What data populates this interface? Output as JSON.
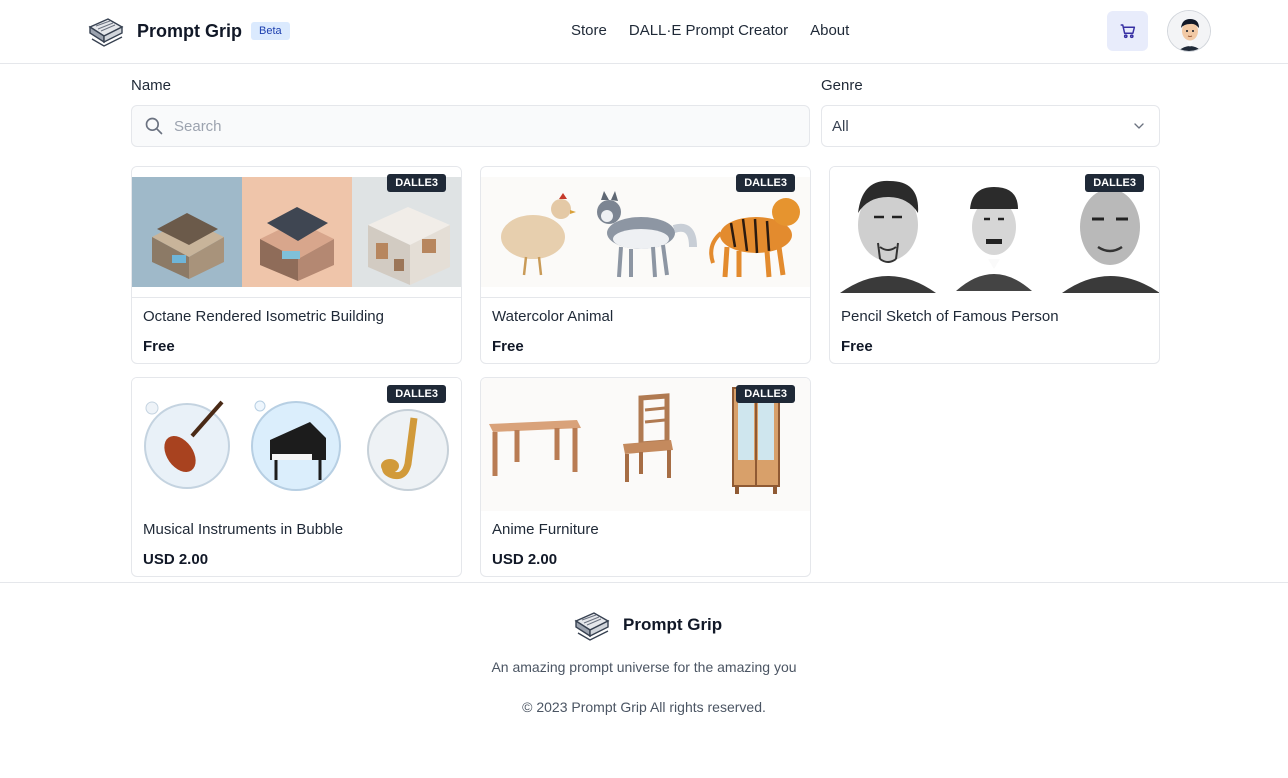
{
  "header": {
    "brand_name": "Prompt Grip",
    "beta_label": "Beta",
    "nav": [
      "Store",
      "DALL·E Prompt Creator",
      "About"
    ],
    "cart_icon": "shopping-cart-icon",
    "avatar_icon": "user-avatar-icon"
  },
  "filters": {
    "name_label": "Name",
    "search_placeholder": "Search",
    "search_value": "",
    "genre_label": "Genre",
    "genre_selected": "All"
  },
  "products": [
    {
      "title": "Octane Rendered Isometric Building",
      "price": "Free",
      "badge": "DALLE3"
    },
    {
      "title": "Watercolor Animal",
      "price": "Free",
      "badge": "DALLE3"
    },
    {
      "title": "Pencil Sketch of Famous Person",
      "price": "Free",
      "badge": "DALLE3"
    },
    {
      "title": "Musical Instruments in Bubble",
      "price": "USD 2.00",
      "badge": "DALLE3"
    },
    {
      "title": "Anime Furniture",
      "price": "USD 2.00",
      "badge": "DALLE3"
    }
  ],
  "footer": {
    "brand_name": "Prompt Grip",
    "tagline": "An amazing prompt universe for the amazing you",
    "copyright": "© 2023 Prompt Grip All rights reserved."
  },
  "colors": {
    "accent_bg": "#e8ecfb",
    "badge_bg": "#1f2937",
    "beta_bg": "#dbeafe",
    "beta_text": "#1e40af"
  }
}
